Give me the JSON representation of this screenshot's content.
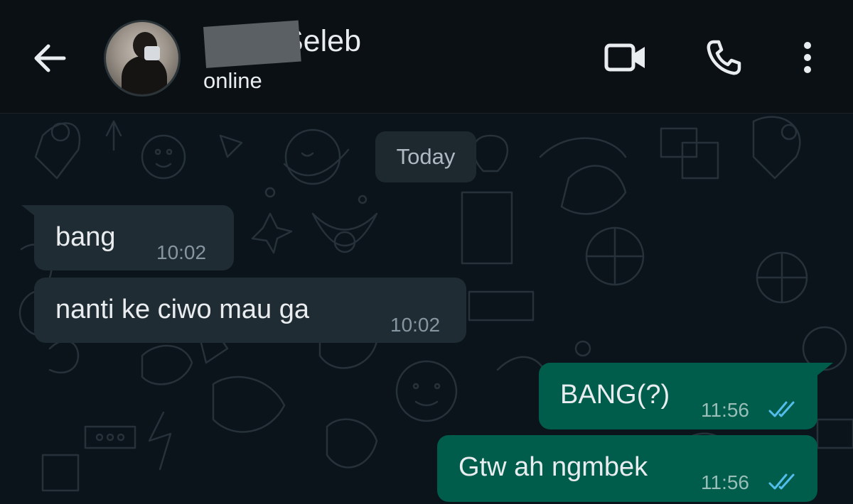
{
  "header": {
    "back_icon": "arrow-left-icon",
    "contact_name": "Seleb",
    "contact_status": "online",
    "video_icon": "video-camera-icon",
    "call_icon": "phone-icon",
    "menu_icon": "more-vertical-icon"
  },
  "chat": {
    "date_label": "Today",
    "messages": [
      {
        "direction": "incoming",
        "text": "bang",
        "time": "10:02"
      },
      {
        "direction": "incoming",
        "text": "nanti ke ciwo mau ga",
        "time": "10:02"
      },
      {
        "direction": "outgoing",
        "text": "BANG(?)",
        "time": "11:56",
        "status": "read"
      },
      {
        "direction": "outgoing",
        "text": "Gtw ah ngmbek",
        "time": "11:56",
        "status": "read"
      }
    ]
  },
  "colors": {
    "background": "#0b141a",
    "header": "#0b1014",
    "incoming_bubble": "#202c33",
    "outgoing_bubble": "#005c4b",
    "read_ticks": "#53bdeb"
  }
}
